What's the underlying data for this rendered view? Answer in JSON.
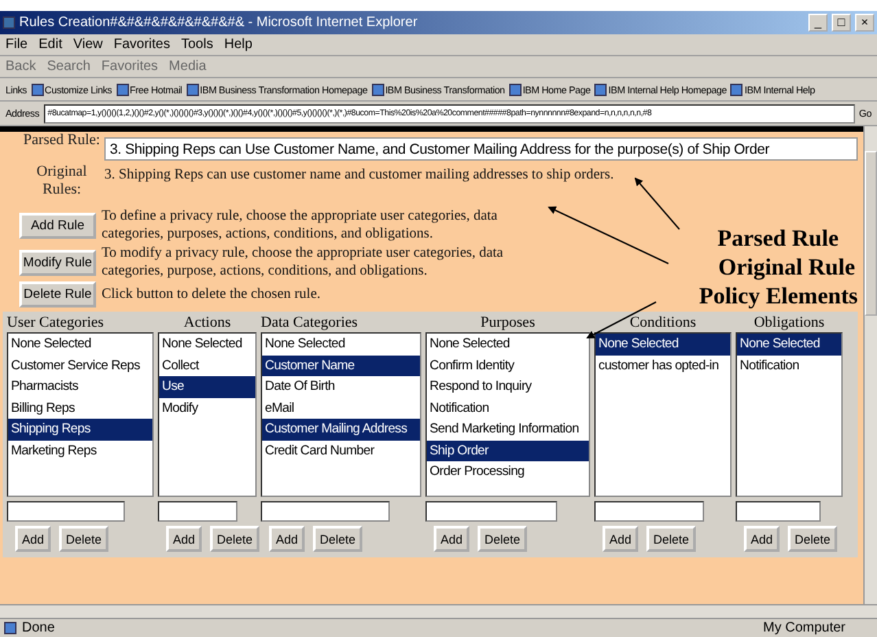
{
  "window": {
    "title": "Rules Creation#&#&#&#&#&#&#&#& - Microsoft Internet Explorer",
    "controls": [
      "_",
      "□",
      "×"
    ]
  },
  "menu": [
    "File",
    "Edit",
    "View",
    "Favorites",
    "Tools",
    "Help"
  ],
  "toolbar": [
    "Back",
    "Search",
    "Favorites",
    "Media"
  ],
  "links": {
    "label": "Links",
    "items": [
      "Customize Links",
      "Free Hotmail",
      "IBM Business Transformation Homepage",
      "IBM Business Transformation",
      "IBM Home Page",
      "IBM Internal Help Homepage",
      "IBM Internal Help"
    ]
  },
  "address": {
    "label": "Address",
    "value": "#8ucatmap=1,y()()()(1,2,)()()#2,y()(*,)()()()()#3,y()()()(*,)()()#4,y()()(*,)()()()#5,y()()()()(*,)(*,)#8ucom=This%20is%20a%20comment#####8path=nynnnnnn#8expand=n,n,n,n,n,n,#8",
    "go": "Go"
  },
  "parsed_rule": {
    "label": "Parsed Rule:",
    "value": "3. Shipping Reps can Use Customer Name, and Customer Mailing Address for the purpose(s) of Ship Order"
  },
  "original_rules": {
    "label": "Original Rules:",
    "text": "3. Shipping Reps can use customer name and customer mailing addresses to ship orders."
  },
  "rule_actions": [
    {
      "button": "Add Rule",
      "help": "To define a privacy rule, choose the appropriate user categories, data categories, purposes, actions, conditions, and obligations."
    },
    {
      "button": "Modify Rule",
      "help": "To modify a privacy rule, choose the appropriate user categories, data categories, purpose, actions, conditions, and obligations."
    },
    {
      "button": "Delete Rule",
      "help": "Click button to delete the chosen rule."
    }
  ],
  "annotations": [
    "Parsed Rule",
    "Original Rule",
    "Policy Elements"
  ],
  "columns": [
    {
      "heading": "User Categories",
      "items": [
        {
          "label": "None Selected",
          "selected": false
        },
        {
          "label": "Customer Service Reps",
          "selected": false
        },
        {
          "label": "Pharmacists",
          "selected": false
        },
        {
          "label": "Billing Reps",
          "selected": false
        },
        {
          "label": "Shipping Reps",
          "selected": true
        },
        {
          "label": "Marketing Reps",
          "selected": false
        }
      ],
      "buttons": [
        "Add",
        "Delete"
      ]
    },
    {
      "heading": "Actions",
      "items": [
        {
          "label": "None Selected",
          "selected": false
        },
        {
          "label": "Collect",
          "selected": false
        },
        {
          "label": "Use",
          "selected": true
        },
        {
          "label": "Modify",
          "selected": false
        }
      ],
      "buttons": [
        "Add",
        "Delete"
      ]
    },
    {
      "heading": "Data Categories",
      "items": [
        {
          "label": "None Selected",
          "selected": false
        },
        {
          "label": "Customer Name",
          "selected": true
        },
        {
          "label": "Date Of Birth",
          "selected": false
        },
        {
          "label": "eMail",
          "selected": false
        },
        {
          "label": "Customer Mailing Address",
          "selected": true
        },
        {
          "label": "Credit Card Number",
          "selected": false
        }
      ],
      "buttons": [
        "Add",
        "Delete"
      ]
    },
    {
      "heading": "Purposes",
      "items": [
        {
          "label": "None Selected",
          "selected": false
        },
        {
          "label": "Confirm Identity",
          "selected": false
        },
        {
          "label": "Respond to Inquiry",
          "selected": false
        },
        {
          "label": "Notification",
          "selected": false
        },
        {
          "label": "Send Marketing Information",
          "selected": false
        },
        {
          "label": "Ship Order",
          "selected": true
        },
        {
          "label": "Order Processing",
          "selected": false
        }
      ],
      "buttons": [
        "Add",
        "Delete"
      ]
    },
    {
      "heading": "Conditions",
      "items": [
        {
          "label": "None Selected",
          "selected": true
        },
        {
          "label": "customer has opted-in",
          "selected": false
        }
      ],
      "buttons": [
        "Add",
        "Delete"
      ]
    },
    {
      "heading": "Obligations",
      "items": [
        {
          "label": "None Selected",
          "selected": true
        },
        {
          "label": "Notification",
          "selected": false
        }
      ],
      "buttons": [
        "Add",
        "Delete"
      ]
    }
  ],
  "status_bar": {
    "text": "Done",
    "zone": "My Computer"
  }
}
